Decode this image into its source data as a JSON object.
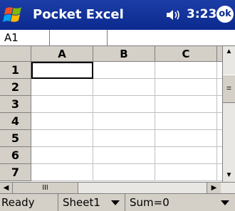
{
  "titlebar": {
    "app_title": "Pocket Excel",
    "clock": "3:23",
    "ok_label": "ok",
    "start_icon": "windows-flag-icon",
    "volume_icon": "speaker-icon"
  },
  "formula_bar": {
    "cell_reference": "A1",
    "formula_value": ""
  },
  "grid": {
    "columns": [
      "A",
      "B",
      "C"
    ],
    "rows": [
      "1",
      "2",
      "3",
      "4",
      "5",
      "6",
      "7"
    ],
    "active_cell": "A1"
  },
  "scrollbar": {
    "h_thumb_label": "III",
    "v_thumb_label": "="
  },
  "statusbar": {
    "status": "Ready",
    "sheet": "Sheet1",
    "sum": "Sum=0"
  },
  "colors": {
    "titlebar": "#0c2a8e",
    "chrome": "#d4d0c8"
  }
}
